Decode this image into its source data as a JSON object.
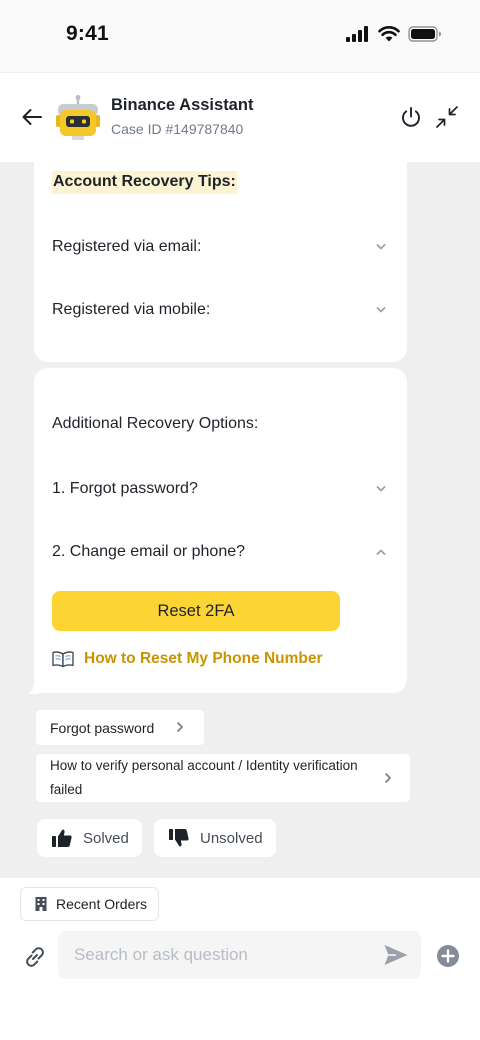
{
  "status_bar": {
    "time": "9:41"
  },
  "header": {
    "title": "Binance Assistant",
    "case_id": "Case ID #149787840",
    "back_icon": "arrow-left-icon",
    "power_icon": "power-icon",
    "minimize_icon": "minimize-arrows-icon"
  },
  "recovery_tips": {
    "title": "Account Recovery Tips:",
    "items": [
      {
        "label": "Registered via email:",
        "expanded": false
      },
      {
        "label": "Registered via mobile:",
        "expanded": false
      }
    ]
  },
  "additional_options": {
    "title": "Additional Recovery Options:",
    "items": [
      {
        "label": "1. Forgot password?",
        "expanded": false
      },
      {
        "label": "2. Change email or phone?",
        "expanded": true
      }
    ],
    "reset_button": "Reset 2FA",
    "guide_icon": "open-book-icon",
    "guide_link": "How to Reset My Phone Number"
  },
  "suggestions": [
    {
      "label": "Forgot password"
    },
    {
      "label": "How to verify personal account / Identity verification failed"
    }
  ],
  "feedback": {
    "solved": "Solved",
    "unsolved": "Unsolved"
  },
  "composer": {
    "recent_orders": "Recent Orders",
    "placeholder": "Search or ask question"
  },
  "colors": {
    "brand_yellow": "#fcd535",
    "link_gold": "#c99400",
    "highlight": "#fcf3d3",
    "chat_bg": "#efefef"
  }
}
